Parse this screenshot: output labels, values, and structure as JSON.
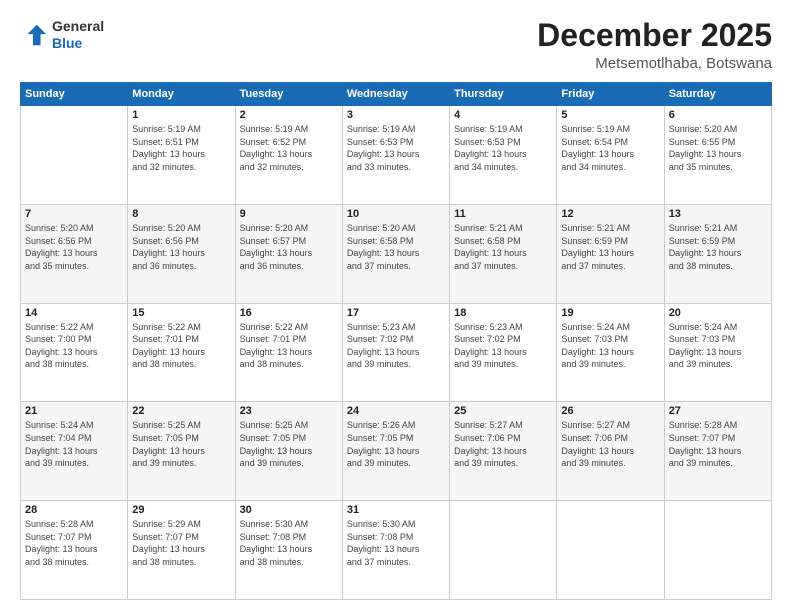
{
  "logo": {
    "line1": "General",
    "line2": "Blue"
  },
  "header": {
    "month": "December 2025",
    "location": "Metsemotlhaba, Botswana"
  },
  "weekdays": [
    "Sunday",
    "Monday",
    "Tuesday",
    "Wednesday",
    "Thursday",
    "Friday",
    "Saturday"
  ],
  "weeks": [
    [
      {
        "day": "",
        "text": ""
      },
      {
        "day": "1",
        "text": "Sunrise: 5:19 AM\nSunset: 6:51 PM\nDaylight: 13 hours\nand 32 minutes."
      },
      {
        "day": "2",
        "text": "Sunrise: 5:19 AM\nSunset: 6:52 PM\nDaylight: 13 hours\nand 32 minutes."
      },
      {
        "day": "3",
        "text": "Sunrise: 5:19 AM\nSunset: 6:53 PM\nDaylight: 13 hours\nand 33 minutes."
      },
      {
        "day": "4",
        "text": "Sunrise: 5:19 AM\nSunset: 6:53 PM\nDaylight: 13 hours\nand 34 minutes."
      },
      {
        "day": "5",
        "text": "Sunrise: 5:19 AM\nSunset: 6:54 PM\nDaylight: 13 hours\nand 34 minutes."
      },
      {
        "day": "6",
        "text": "Sunrise: 5:20 AM\nSunset: 6:55 PM\nDaylight: 13 hours\nand 35 minutes."
      }
    ],
    [
      {
        "day": "7",
        "text": "Sunrise: 5:20 AM\nSunset: 6:56 PM\nDaylight: 13 hours\nand 35 minutes."
      },
      {
        "day": "8",
        "text": "Sunrise: 5:20 AM\nSunset: 6:56 PM\nDaylight: 13 hours\nand 36 minutes."
      },
      {
        "day": "9",
        "text": "Sunrise: 5:20 AM\nSunset: 6:57 PM\nDaylight: 13 hours\nand 36 minutes."
      },
      {
        "day": "10",
        "text": "Sunrise: 5:20 AM\nSunset: 6:58 PM\nDaylight: 13 hours\nand 37 minutes."
      },
      {
        "day": "11",
        "text": "Sunrise: 5:21 AM\nSunset: 6:58 PM\nDaylight: 13 hours\nand 37 minutes."
      },
      {
        "day": "12",
        "text": "Sunrise: 5:21 AM\nSunset: 6:59 PM\nDaylight: 13 hours\nand 37 minutes."
      },
      {
        "day": "13",
        "text": "Sunrise: 5:21 AM\nSunset: 6:59 PM\nDaylight: 13 hours\nand 38 minutes."
      }
    ],
    [
      {
        "day": "14",
        "text": "Sunrise: 5:22 AM\nSunset: 7:00 PM\nDaylight: 13 hours\nand 38 minutes."
      },
      {
        "day": "15",
        "text": "Sunrise: 5:22 AM\nSunset: 7:01 PM\nDaylight: 13 hours\nand 38 minutes."
      },
      {
        "day": "16",
        "text": "Sunrise: 5:22 AM\nSunset: 7:01 PM\nDaylight: 13 hours\nand 38 minutes."
      },
      {
        "day": "17",
        "text": "Sunrise: 5:23 AM\nSunset: 7:02 PM\nDaylight: 13 hours\nand 39 minutes."
      },
      {
        "day": "18",
        "text": "Sunrise: 5:23 AM\nSunset: 7:02 PM\nDaylight: 13 hours\nand 39 minutes."
      },
      {
        "day": "19",
        "text": "Sunrise: 5:24 AM\nSunset: 7:03 PM\nDaylight: 13 hours\nand 39 minutes."
      },
      {
        "day": "20",
        "text": "Sunrise: 5:24 AM\nSunset: 7:03 PM\nDaylight: 13 hours\nand 39 minutes."
      }
    ],
    [
      {
        "day": "21",
        "text": "Sunrise: 5:24 AM\nSunset: 7:04 PM\nDaylight: 13 hours\nand 39 minutes."
      },
      {
        "day": "22",
        "text": "Sunrise: 5:25 AM\nSunset: 7:05 PM\nDaylight: 13 hours\nand 39 minutes."
      },
      {
        "day": "23",
        "text": "Sunrise: 5:25 AM\nSunset: 7:05 PM\nDaylight: 13 hours\nand 39 minutes."
      },
      {
        "day": "24",
        "text": "Sunrise: 5:26 AM\nSunset: 7:05 PM\nDaylight: 13 hours\nand 39 minutes."
      },
      {
        "day": "25",
        "text": "Sunrise: 5:27 AM\nSunset: 7:06 PM\nDaylight: 13 hours\nand 39 minutes."
      },
      {
        "day": "26",
        "text": "Sunrise: 5:27 AM\nSunset: 7:06 PM\nDaylight: 13 hours\nand 39 minutes."
      },
      {
        "day": "27",
        "text": "Sunrise: 5:28 AM\nSunset: 7:07 PM\nDaylight: 13 hours\nand 39 minutes."
      }
    ],
    [
      {
        "day": "28",
        "text": "Sunrise: 5:28 AM\nSunset: 7:07 PM\nDaylight: 13 hours\nand 38 minutes."
      },
      {
        "day": "29",
        "text": "Sunrise: 5:29 AM\nSunset: 7:07 PM\nDaylight: 13 hours\nand 38 minutes."
      },
      {
        "day": "30",
        "text": "Sunrise: 5:30 AM\nSunset: 7:08 PM\nDaylight: 13 hours\nand 38 minutes."
      },
      {
        "day": "31",
        "text": "Sunrise: 5:30 AM\nSunset: 7:08 PM\nDaylight: 13 hours\nand 37 minutes."
      },
      {
        "day": "",
        "text": ""
      },
      {
        "day": "",
        "text": ""
      },
      {
        "day": "",
        "text": ""
      }
    ]
  ],
  "row_shades": [
    false,
    true,
    false,
    true,
    false
  ]
}
